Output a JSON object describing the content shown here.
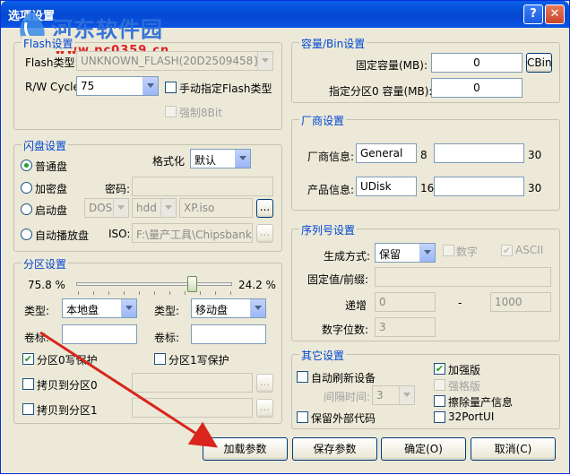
{
  "window": {
    "title": "选项设置",
    "help_label": "?",
    "close_label": "✕"
  },
  "watermark": {
    "site_name": "河东软件园",
    "url": "www.pc0359.cn"
  },
  "flash_group": {
    "title": "Flash设置",
    "type_label": "Flash类型:",
    "type_value": "UNKNOWN_FLASH(20D2509458}",
    "rw_cycle_label": "R/W Cycle:",
    "rw_cycle_value": "75",
    "manual_type_label": "手动指定Flash类型",
    "force_8bit_label": "强制8Bit"
  },
  "disk_group": {
    "title": "闪盘设置",
    "format_label": "格式化",
    "format_value": "默认",
    "normal_label": "普通盘",
    "encrypted_label": "加密盘",
    "password_label": "密码:",
    "boot_label": "启动盘",
    "boot_os_value": "DOS",
    "boot_disk_value": "hdd",
    "boot_image_value": "XP.iso",
    "autorun_label": "自动播放盘",
    "iso_label": "ISO:",
    "iso_path_value": "F:\\量产工具\\Chipsbank\\C",
    "browse_label": "..."
  },
  "partition_group": {
    "title": "分区设置",
    "left_percent": "75.8 %",
    "right_percent": "24.2 %",
    "slider_fraction": 0.758,
    "type1_label": "类型:",
    "type1_value": "本地盘",
    "type2_label": "类型:",
    "type2_value": "移动盘",
    "label1_label": "卷标:",
    "label2_label": "卷标:",
    "p0_protect_label": "分区0写保护",
    "p1_protect_label": "分区1写保护",
    "copy_p0_label": "拷贝到分区0",
    "copy_p1_label": "拷贝到分区1",
    "browse_label": "..."
  },
  "capacity_group": {
    "title": "容量/Bin设置",
    "fixed_label": "固定容量(MB):",
    "fixed_value": "0",
    "cbin_label": "CBin",
    "partition0_label": "指定分区0 容量(MB):",
    "partition0_value": "0"
  },
  "vendor_group": {
    "title": "厂商设置",
    "vendor_info_label": "厂商信息:",
    "vendor_info_value": "General",
    "vendor_num": "8",
    "vendor_max": "30",
    "product_info_label": "产品信息:",
    "product_info_value": "UDisk",
    "product_num": "16",
    "product_max": "30"
  },
  "serial_group": {
    "title": "序列号设置",
    "gen_mode_label": "生成方式:",
    "gen_mode_value": "保留",
    "digit_label": "数字",
    "ascii_label": "ASCII",
    "fixed_prefix_label": "固定值/前缀:",
    "increment_label": "递增",
    "increment_from": "0",
    "dash": "-",
    "increment_to": "1000",
    "digits_label": "数字位数:",
    "digits_value": "3"
  },
  "other_group": {
    "title": "其它设置",
    "auto_refresh_label": "自动刷新设备",
    "interval_label": "间隔时间:",
    "interval_value": "3",
    "enhanced_label": "加强版",
    "strong_label": "强格版",
    "erase_label": "擦除量产信息",
    "keep_code_label": "保留外部代码",
    "port_ui_label": "32PortUI"
  },
  "buttons": {
    "load_label": "加载参数",
    "save_label": "保存参数",
    "ok_label": "确定(O)",
    "cancel_label": "取消(C)"
  },
  "colors": {
    "group_title": "#0046d5",
    "window_bg": "#ece9d8",
    "titlebar": "#0a5fe8",
    "annotation_arrow": "#d9261c"
  }
}
